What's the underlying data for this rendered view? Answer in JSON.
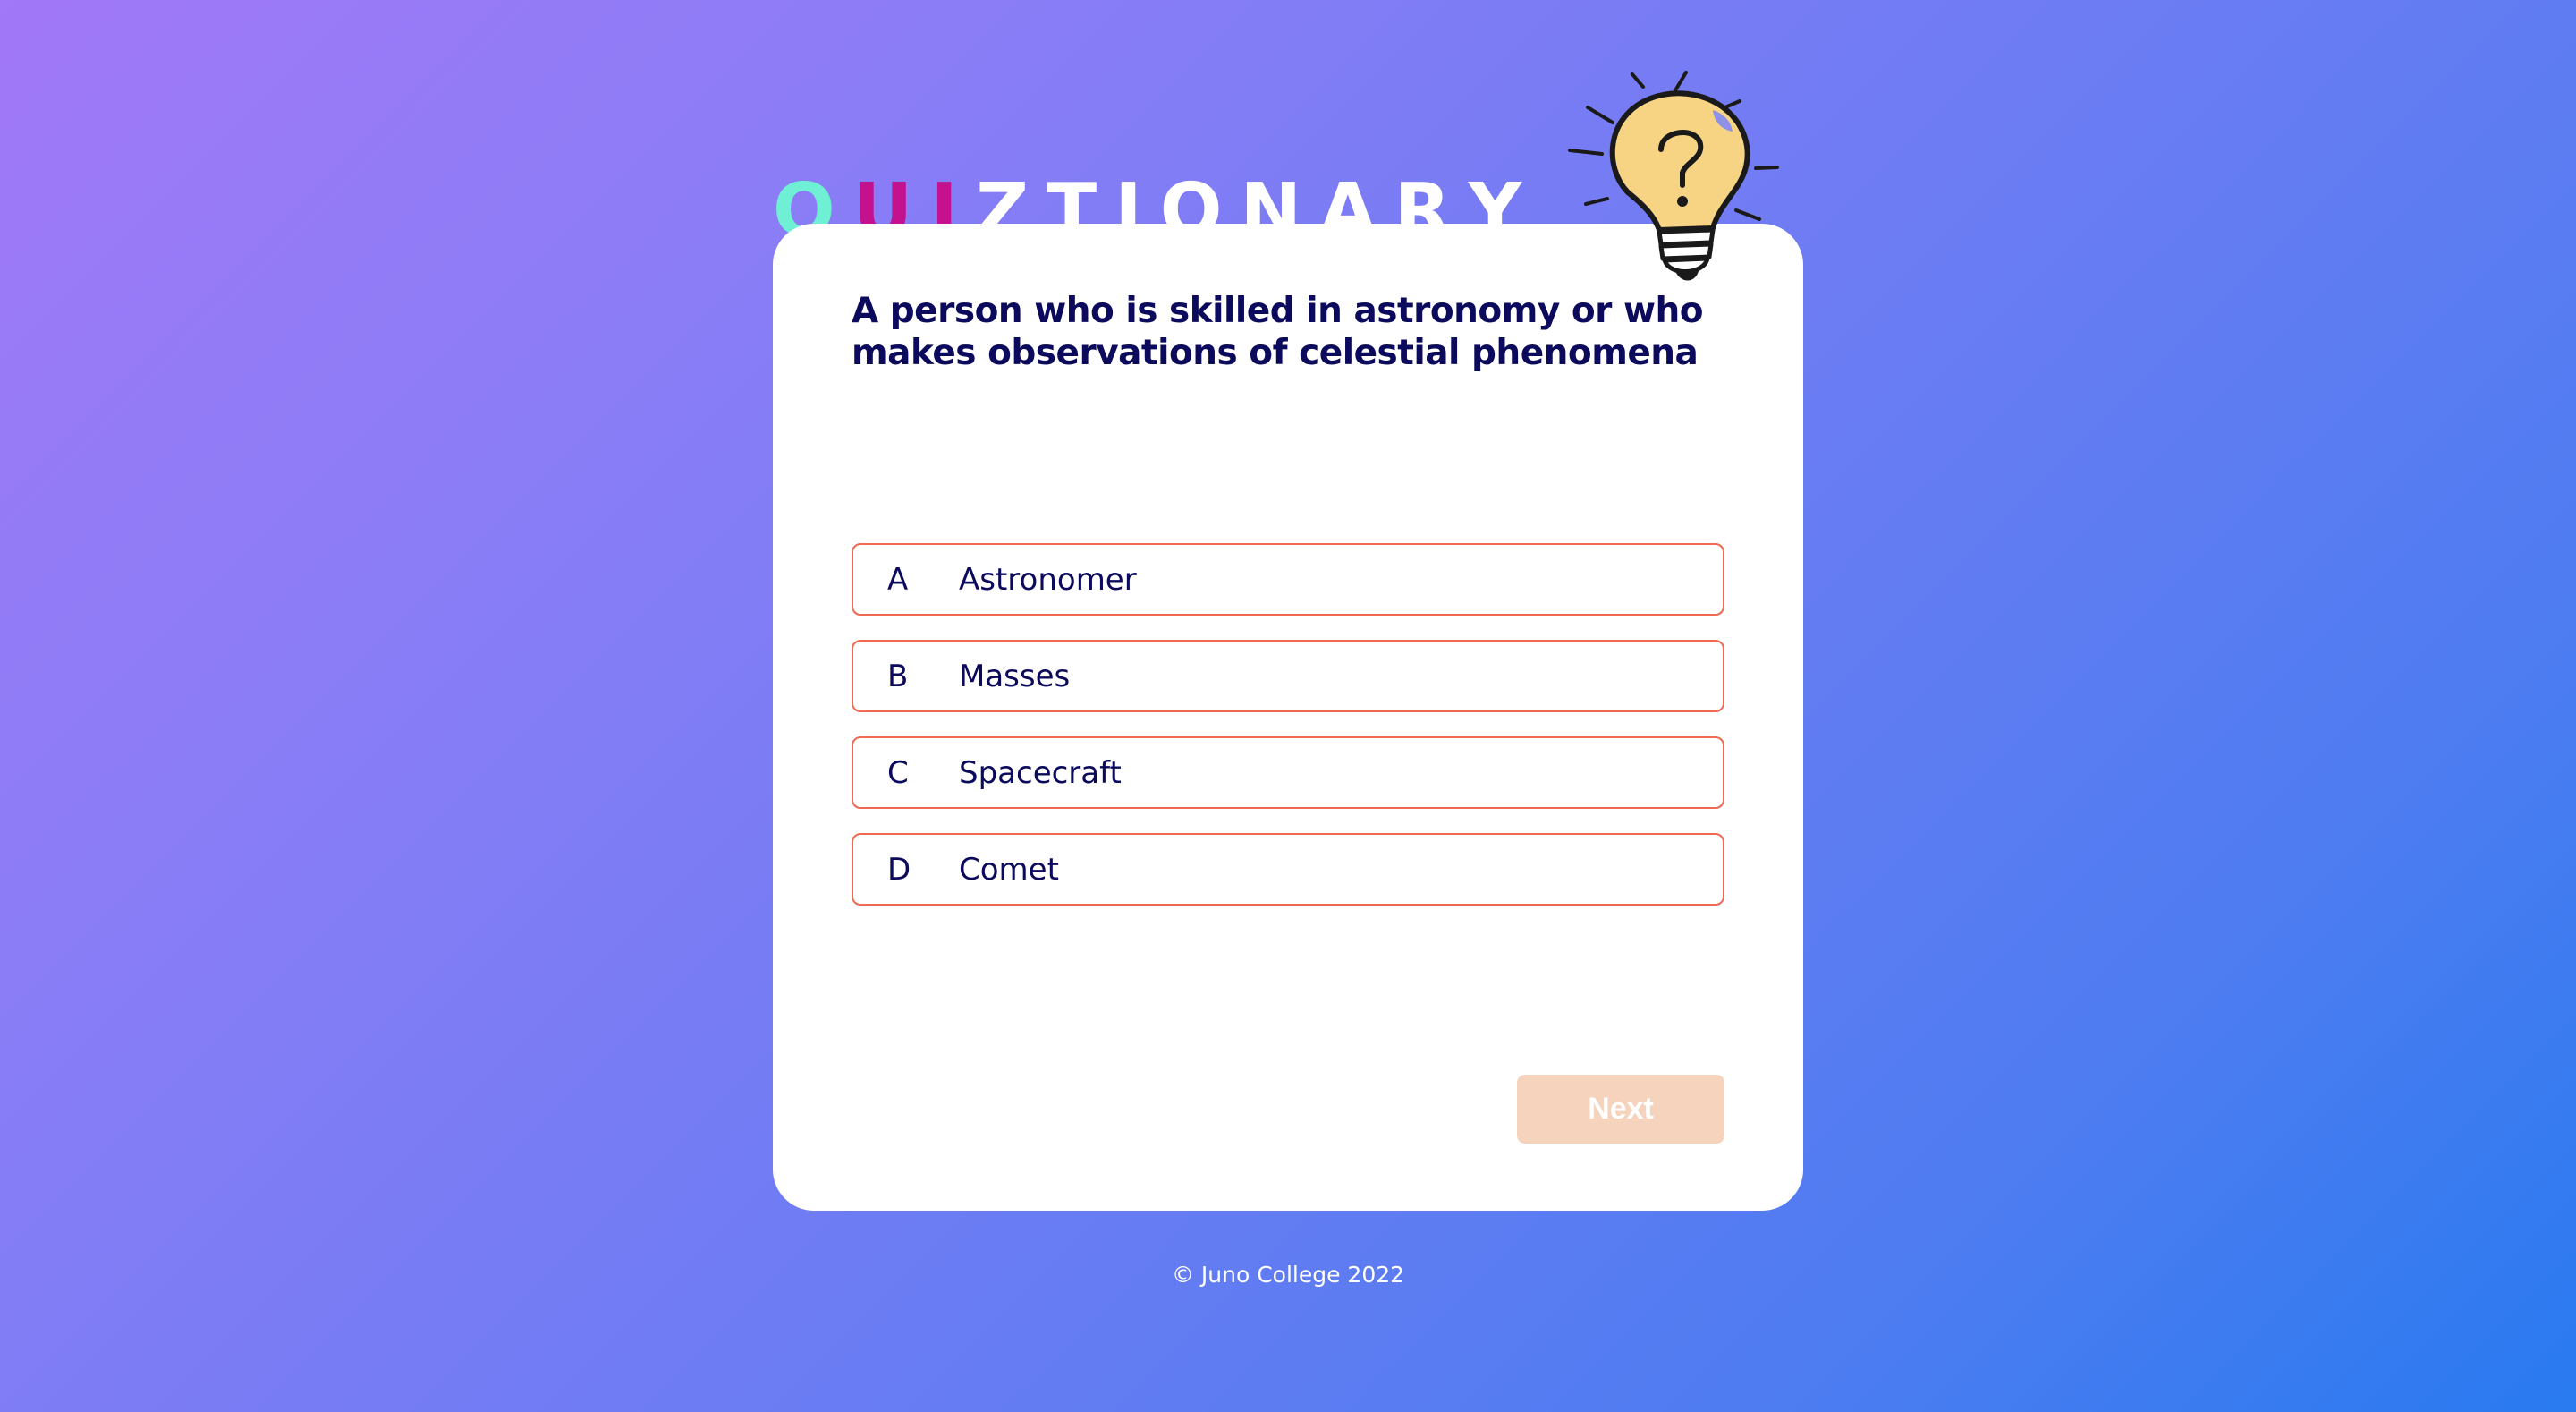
{
  "logo": {
    "letters": [
      {
        "char": "Q",
        "color": "#6ff0d4"
      },
      {
        "char": "U",
        "color": "#c4128f"
      },
      {
        "char": "I",
        "color": "#c4128f"
      },
      {
        "char": "Z",
        "color": "#ffffff"
      },
      {
        "char": "T",
        "color": "#ffffff"
      },
      {
        "char": "I",
        "color": "#ffffff"
      },
      {
        "char": "O",
        "color": "#ffffff"
      },
      {
        "char": "N",
        "color": "#ffffff"
      },
      {
        "char": "A",
        "color": "#ffffff"
      },
      {
        "char": "R",
        "color": "#ffffff"
      },
      {
        "char": "Y",
        "color": "#ffffff"
      }
    ],
    "icon": "lightbulb-question-icon"
  },
  "quiz": {
    "question": "A person who is skilled in astronomy or who makes observations of celestial phenomena",
    "answers": [
      {
        "letter": "A",
        "text": "Astronomer"
      },
      {
        "letter": "B",
        "text": "Masses"
      },
      {
        "letter": "C",
        "text": "Spacecraft"
      },
      {
        "letter": "D",
        "text": "Comet"
      }
    ],
    "next_label": "Next"
  },
  "footer": {
    "text": "© Juno College 2022"
  },
  "colors": {
    "accent_border": "#ef6a50",
    "text_dark": "#0b0a5c",
    "next_disabled": "#f6d3bc"
  }
}
